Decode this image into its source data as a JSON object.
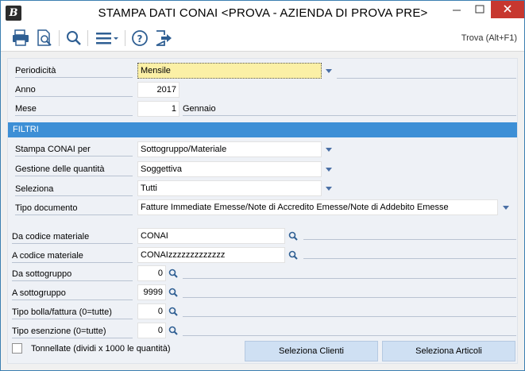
{
  "window": {
    "app_icon_letter": "B",
    "title": "STAMPA DATI CONAI <PROVA - AZIENDA DI PROVA PRE>"
  },
  "toolbar": {
    "search_label": "Trova (Alt+F1)",
    "icons": [
      "printer-icon",
      "print-preview-icon",
      "search-icon",
      "menu-icon",
      "help-icon",
      "exit-icon"
    ]
  },
  "form": {
    "periodicita": {
      "label": "Periodicità",
      "value": "Mensile"
    },
    "anno": {
      "label": "Anno",
      "value": "2017"
    },
    "mese": {
      "label": "Mese",
      "value": "1",
      "description": "Gennaio"
    }
  },
  "filters": {
    "section_title": "FILTRI",
    "stampa_conai_per": {
      "label": "Stampa CONAI per",
      "value": "Sottogruppo/Materiale"
    },
    "gestione_quantita": {
      "label": "Gestione delle quantità",
      "value": "Soggettiva"
    },
    "seleziona": {
      "label": "Seleziona",
      "value": "Tutti"
    },
    "tipo_documento": {
      "label": "Tipo documento",
      "value": "Fatture Immediate Emesse/Note di Accredito Emesse/Note di Addebito Emesse"
    },
    "da_codice_materiale": {
      "label": "Da codice materiale",
      "value": "CONAI"
    },
    "a_codice_materiale": {
      "label": "A codice materiale",
      "value": "CONAIzzzzzzzzzzzzz"
    },
    "da_sottogruppo": {
      "label": "Da sottogruppo",
      "value": "0"
    },
    "a_sottogruppo": {
      "label": "A sottogruppo",
      "value": "9999"
    },
    "tipo_bolla_fattura": {
      "label": "Tipo bolla/fattura (0=tutte)",
      "value": "0"
    },
    "tipo_esenzione": {
      "label": "Tipo esenzione (0=tutte)",
      "value": "0"
    }
  },
  "footer": {
    "tonnellate_label": "Tonnellate (dividi x 1000 le quantità)",
    "tonnellate_checked": false,
    "seleziona_clienti": "Seleziona Clienti",
    "seleziona_articoli": "Seleziona Articoli"
  },
  "colors": {
    "section_bar": "#3d8fd6",
    "close_button": "#c7372f",
    "focused_field": "#fbf0a6",
    "action_button": "#cfe0f3"
  }
}
